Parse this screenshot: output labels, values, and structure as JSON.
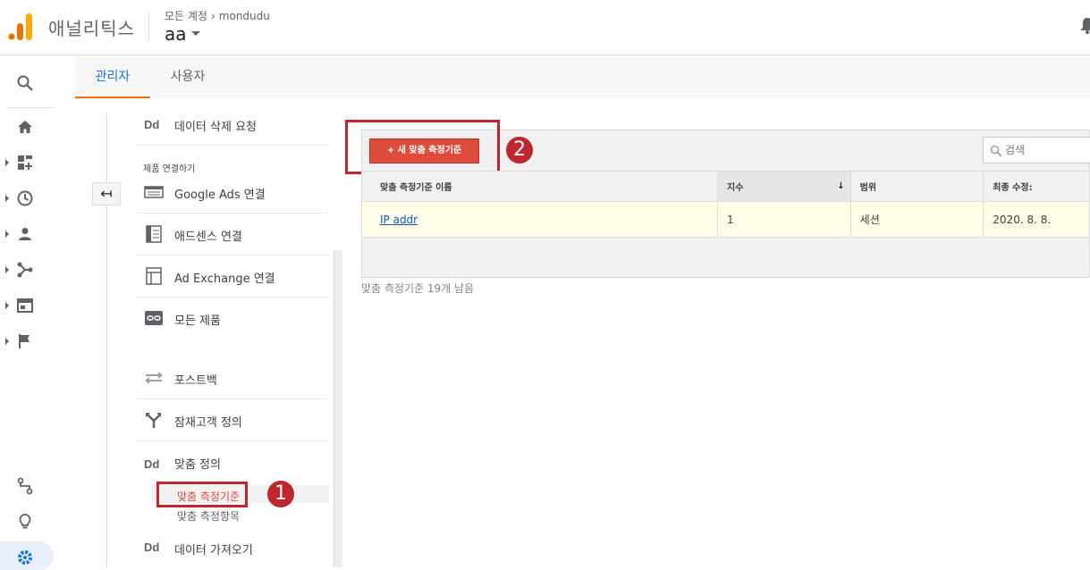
{
  "header": {
    "app_title": "애널리틱스",
    "breadcrumb": [
      "모든 계정",
      "mondudu"
    ],
    "breadcrumb_separator": "›",
    "account_name": "aa"
  },
  "tabs": [
    {
      "label": "관리자",
      "active": true
    },
    {
      "label": "사용자",
      "active": false
    }
  ],
  "admin_nav": {
    "back_icon": "↤",
    "section_label": "제품 연결하기",
    "items": [
      {
        "label": "데이터 삭제 요청",
        "icon": "dd-icon"
      },
      {
        "label": "Google Ads 연결",
        "icon": "google-ads-icon"
      },
      {
        "label": "애드센스 연결",
        "icon": "adsense-icon"
      },
      {
        "label": "Ad Exchange 연결",
        "icon": "ad-exchange-icon"
      },
      {
        "label": "모든 제품",
        "icon": "link-icon"
      },
      {
        "label": "포스트백",
        "icon": "postback-icon"
      },
      {
        "label": "잠재고객 정의",
        "icon": "audience-icon"
      },
      {
        "label": "맞춤 정의",
        "icon": "dd-icon"
      },
      {
        "label": "데이터 가져오기",
        "icon": "dd-icon"
      }
    ],
    "dd_text": "Dd",
    "sub_items": [
      {
        "label": "맞춤 측정기준",
        "active": true
      },
      {
        "label": "맞춤 측정항목",
        "active": false
      }
    ]
  },
  "annotations": {
    "badge1": "1",
    "badge2": "2"
  },
  "toolbar": {
    "new_button": "+ 새 맞춤 측정기준",
    "search_placeholder": "검색"
  },
  "table": {
    "columns": [
      "맞춤 측정기준 이름",
      "지수",
      "범위",
      "최종 수정:"
    ],
    "sort_indicator": "↓",
    "rows": [
      {
        "name": "IP addr",
        "index": "1",
        "scope": "세션",
        "modified": "2020. 8. 8."
      }
    ]
  },
  "footer_note": "맞춤 측정기준 19개 남음",
  "colors": {
    "accent_blue": "#1a73e8",
    "tab_underline": "#e8710a",
    "button_red": "#dd4b39",
    "highlight_box": "#c0262d",
    "row_highlight": "#fffde7"
  }
}
